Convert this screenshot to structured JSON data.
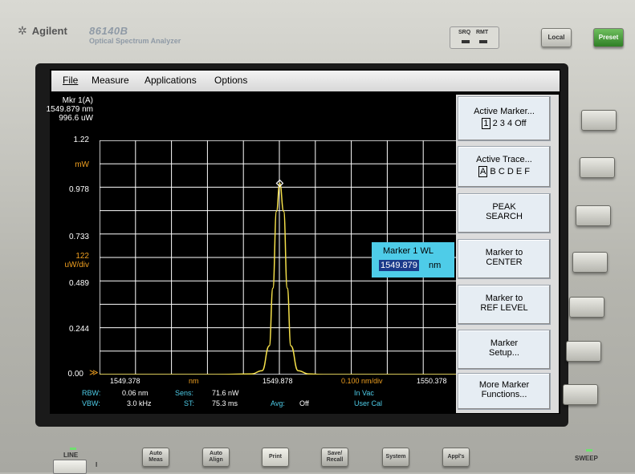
{
  "instrument": {
    "brand": "Agilent",
    "model": "86140B",
    "product": "Optical Spectrum Analyzer",
    "status_labels": [
      "SRQ",
      "RMT"
    ],
    "local_label": "Local",
    "preset_label": "Preset",
    "line_label": "LINE",
    "power_mark": "I",
    "sweep_label": "SWEEP"
  },
  "menu": {
    "file": "File",
    "measure": "Measure",
    "applications": "Applications",
    "options": "Options"
  },
  "marker_readout": {
    "name": "Mkr 1(A)",
    "wavelength": "1549.879 nm",
    "power": "996.6 uW"
  },
  "y_axis": {
    "top": "1.22",
    "unit": "mW",
    "t1": "0.978",
    "t2": "0.733",
    "scale_value": "122",
    "scale_unit": "uW/div",
    "t3": "0.489",
    "t4": "0.244",
    "bottom": "0.00"
  },
  "x_axis": {
    "start": "1549.378",
    "unit": "nm",
    "center": "1549.878",
    "span_div": "0.100 nm/div",
    "stop": "1550.378"
  },
  "settings": {
    "rbw_label": "RBW:",
    "rbw_value": "0.06 nm",
    "vbw_label": "VBW:",
    "vbw_value": "3.0 kHz",
    "sens_label": "Sens:",
    "sens_value": "71.6 nW",
    "st_label": "ST:",
    "st_value": "75.3 ms",
    "avg_label": "Avg:",
    "avg_value": "Off",
    "medium": "In Vac",
    "cal": "User Cal"
  },
  "marker_dialog": {
    "title": "Marker 1 WL",
    "value": "1549.879",
    "unit": "nm"
  },
  "softkeys": {
    "active_marker": "Active Marker...",
    "marker_options": [
      "1",
      "2",
      "3",
      "4",
      "Off"
    ],
    "active_trace": "Active Trace...",
    "trace_options": [
      "A",
      "B",
      "C",
      "D",
      "E",
      "F"
    ],
    "peak_search_1": "PEAK",
    "peak_search_2": "SEARCH",
    "marker_to_center_1": "Marker to",
    "marker_to_center_2": "CENTER",
    "marker_to_ref_1": "Marker to",
    "marker_to_ref_2": "REF LEVEL",
    "marker_setup_1": "Marker",
    "marker_setup_2": "Setup...",
    "more_marker_1": "More Marker",
    "more_marker_2": "Functions..."
  },
  "front_buttons": {
    "auto_meas": [
      "Auto",
      "Meas"
    ],
    "auto_align": [
      "Auto",
      "Align"
    ],
    "print": "Print",
    "save_recall": [
      "Save/",
      "Recall"
    ],
    "system": "System",
    "appls": "Appl's"
  },
  "chart_data": {
    "type": "line",
    "xlim": [
      1549.378,
      1550.378
    ],
    "ylim": [
      0,
      1.22
    ],
    "grid": true,
    "series": [
      {
        "x": [
          1549.378,
          1549.7,
          1549.8,
          1549.83,
          1549.85,
          1549.86,
          1549.87,
          1549.879,
          1549.89,
          1549.9,
          1549.91,
          1549.93,
          1549.96,
          1550.0,
          1550.378
        ],
        "y": [
          0.0,
          0.0,
          0.003,
          0.02,
          0.15,
          0.45,
          0.85,
          0.9966,
          0.85,
          0.45,
          0.15,
          0.02,
          0.003,
          0.0,
          0.0
        ]
      }
    ],
    "marker": {
      "x": 1549.879,
      "y": 0.9966
    }
  }
}
